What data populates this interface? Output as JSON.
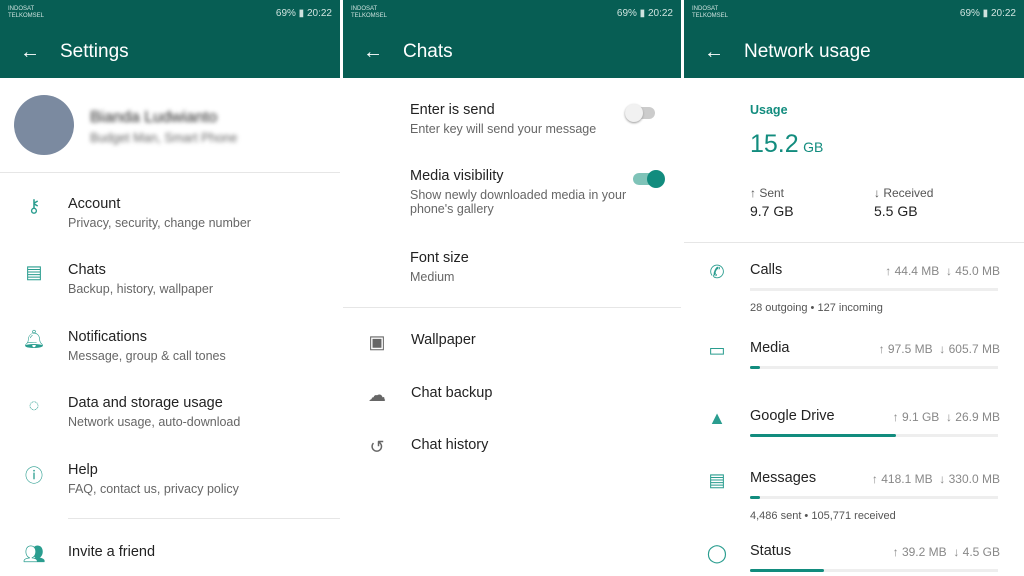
{
  "status_bar": {
    "carrier": "INDOSAT TELKOMSEL",
    "battery": "69%",
    "time": "20:22"
  },
  "settings": {
    "title": "Settings",
    "profile": {
      "name": "Bianda Ludwianto",
      "about": "Budget Man, Smart Phone"
    },
    "items": [
      {
        "icon": "key-icon",
        "label": "Account",
        "sub": "Privacy, security, change number"
      },
      {
        "icon": "chat-icon",
        "label": "Chats",
        "sub": "Backup, history, wallpaper"
      },
      {
        "icon": "bell-icon",
        "label": "Notifications",
        "sub": "Message, group & call tones"
      },
      {
        "icon": "data-usage-icon",
        "label": "Data and storage usage",
        "sub": "Network usage, auto-download"
      },
      {
        "icon": "help-icon",
        "label": "Help",
        "sub": "FAQ, contact us, privacy policy"
      },
      {
        "icon": "people-icon",
        "label": "Invite a friend",
        "sub": ""
      }
    ]
  },
  "chats": {
    "title": "Chats",
    "enter_send": {
      "label": "Enter is send",
      "sub": "Enter key will send your message",
      "on": false
    },
    "media_visibility": {
      "label": "Media visibility",
      "sub": "Show newly downloaded media in your phone's gallery",
      "on": true
    },
    "font_size": {
      "label": "Font size",
      "sub": "Medium"
    },
    "items": [
      {
        "icon": "wallpaper-icon",
        "label": "Wallpaper"
      },
      {
        "icon": "cloud-icon",
        "label": "Chat backup"
      },
      {
        "icon": "history-icon",
        "label": "Chat history"
      }
    ]
  },
  "network": {
    "title": "Network usage",
    "usage_label": "Usage",
    "total": "15.2",
    "total_unit": "GB",
    "sent_label": "↑ Sent",
    "sent": "9.7 GB",
    "received_label": "↓ Received",
    "received": "5.5 GB",
    "items": [
      {
        "icon": "phone-icon",
        "label": "Calls",
        "up": "↑ 44.4 MB",
        "down": "↓ 45.0 MB",
        "progress": 0,
        "note": "28 outgoing • 127 incoming"
      },
      {
        "icon": "media-icon",
        "label": "Media",
        "up": "↑ 97.5 MB",
        "down": "↓ 605.7 MB",
        "progress": 4,
        "note": ""
      },
      {
        "icon": "drive-icon",
        "label": "Google Drive",
        "up": "↑ 9.1 GB",
        "down": "↓ 26.9 MB",
        "progress": 59,
        "note": ""
      },
      {
        "icon": "message-icon",
        "label": "Messages",
        "up": "↑ 418.1 MB",
        "down": "↓ 330.0 MB",
        "progress": 4,
        "note": "4,486 sent • 105,771 received"
      },
      {
        "icon": "status-icon",
        "label": "Status",
        "up": "↑ 39.2 MB",
        "down": "↓ 4.5 GB",
        "progress": 30,
        "note": ""
      }
    ]
  },
  "colors": {
    "header": "#075e54",
    "accent": "#128c7e"
  }
}
